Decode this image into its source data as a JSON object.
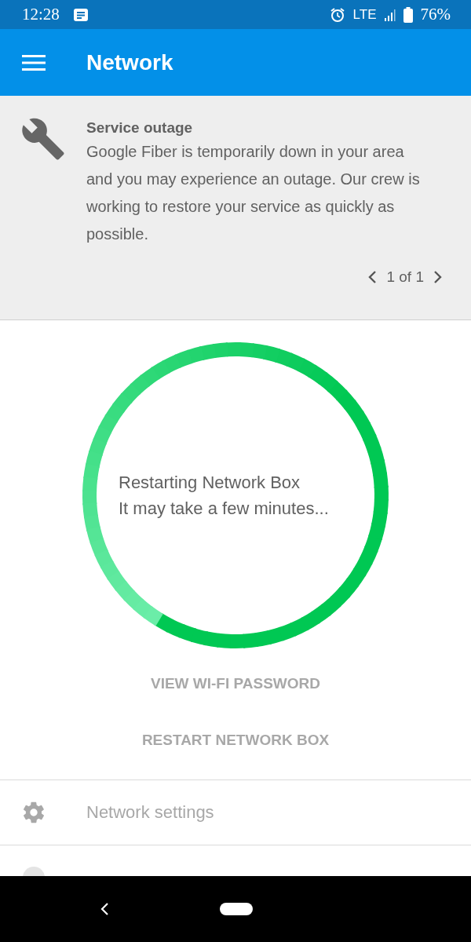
{
  "status_bar": {
    "time": "12:28",
    "network": "LTE",
    "battery": "76%"
  },
  "app_bar": {
    "title": "Network"
  },
  "notice": {
    "title": "Service outage",
    "body": "Google Fiber is temporarily down in your area and you may experience an outage. Our crew is working to restore your service as quickly as possible.",
    "pager": "1 of 1"
  },
  "progress": {
    "lines": [
      "Restarting Network Box",
      "It may take a few minutes..."
    ]
  },
  "buttons": [
    {
      "label": "VIEW WI-FI PASSWORD",
      "disabled": true
    },
    {
      "label": "RESTART NETWORK BOX",
      "disabled": true
    }
  ],
  "menu": [
    {
      "label": "Network settings",
      "disabled": true
    }
  ]
}
